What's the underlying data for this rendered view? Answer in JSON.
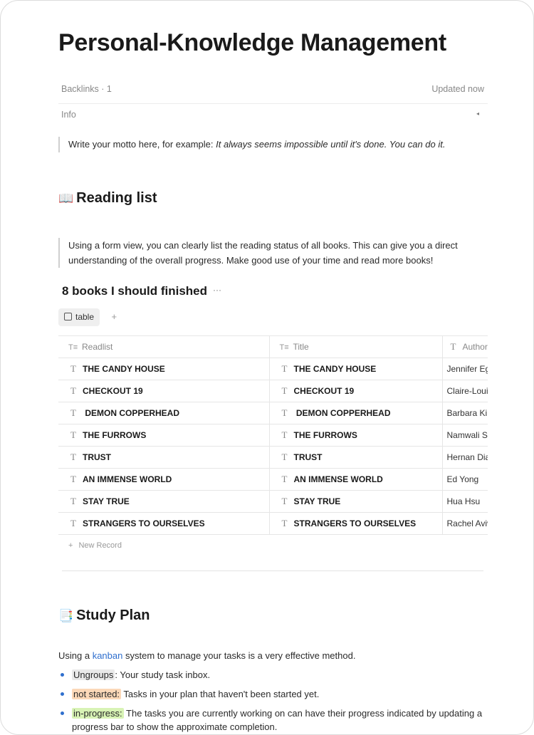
{
  "page": {
    "title": "Personal-Knowledge Management",
    "backlinks": "Backlinks · 1",
    "updated": "Updated now",
    "info_label": "Info",
    "info_caret": "◂",
    "motto_prefix": "Write your motto here, for example: ",
    "motto_italic": "It always seems impossible until it's done. You can do it."
  },
  "reading": {
    "emoji": "📖",
    "heading": "Reading list",
    "description": "Using a form view, you can clearly list the reading status of all books. This can give you a direct understanding of the overall progress. Make good use of your time and read more books!",
    "view_title": "8 books I should finished",
    "view_more": "···",
    "tab_label": "table",
    "tab_add": "+",
    "columns": [
      "Readlist",
      "Title",
      "Author"
    ],
    "rows": [
      {
        "readlist": "THE CANDY HOUSE",
        "title": "THE CANDY HOUSE",
        "author": "Jennifer Eg"
      },
      {
        "readlist": "CHECKOUT 19",
        "title": "CHECKOUT 19",
        "author": "Claire-Loui"
      },
      {
        "readlist": " DEMON COPPERHEAD",
        "title": " DEMON COPPERHEAD",
        "author": "Barbara Kir"
      },
      {
        "readlist": "THE FURROWS",
        "title": "THE FURROWS",
        "author": "Namwali Se"
      },
      {
        "readlist": "TRUST",
        "title": "TRUST",
        "author": "Hernan Dia"
      },
      {
        "readlist": "AN IMMENSE WORLD",
        "title": "AN IMMENSE WORLD",
        "author": "Ed Yong"
      },
      {
        "readlist": "STAY TRUE",
        "title": "STAY TRUE",
        "author": "Hua Hsu"
      },
      {
        "readlist": "STRANGERS TO OURSELVES",
        "title": "STRANGERS TO OURSELVES",
        "author": "Rachel Aviv"
      }
    ],
    "new_record": "New Record"
  },
  "study": {
    "emoji": "📑",
    "heading": "Study Plan",
    "intro_before": "Using a ",
    "intro_link": "kanban",
    "intro_after": " system to manage your tasks is a very effective method.",
    "bullets": [
      {
        "tag": "Ungroups",
        "text": ": Your study task inbox."
      },
      {
        "tag": "not started:",
        "text": " Tasks in your plan that haven't been started yet."
      },
      {
        "tag": "in-progress:",
        "text": " The tasks you are currently working on can have their progress indicated by updating a progress bar to show the approximate completion."
      }
    ]
  }
}
